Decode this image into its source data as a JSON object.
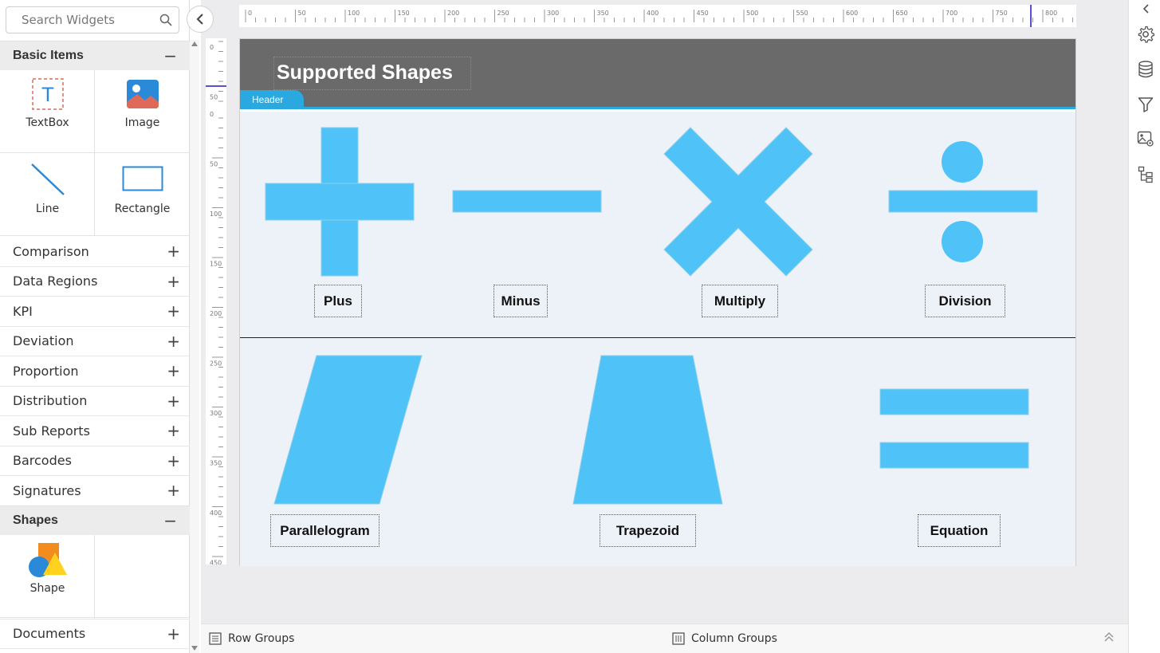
{
  "search": {
    "placeholder": "Search Widgets"
  },
  "sections": {
    "basic_items": {
      "label": "Basic Items",
      "toggle": "−"
    },
    "shapes": {
      "label": "Shapes",
      "toggle": "−"
    }
  },
  "basic_widgets": [
    {
      "label": "TextBox",
      "icon": "textbox-icon"
    },
    {
      "label": "Image",
      "icon": "image-icon"
    },
    {
      "label": "Line",
      "icon": "line-icon"
    },
    {
      "label": "Rectangle",
      "icon": "rectangle-icon"
    }
  ],
  "groups": [
    {
      "label": "Comparison",
      "toggle": "+"
    },
    {
      "label": "Data Regions",
      "toggle": "+"
    },
    {
      "label": "KPI",
      "toggle": "+"
    },
    {
      "label": "Deviation",
      "toggle": "+"
    },
    {
      "label": "Proportion",
      "toggle": "+"
    },
    {
      "label": "Distribution",
      "toggle": "+"
    },
    {
      "label": "Sub Reports",
      "toggle": "+"
    },
    {
      "label": "Barcodes",
      "toggle": "+"
    },
    {
      "label": "Signatures",
      "toggle": "+"
    }
  ],
  "shape_widget": {
    "label": "Shape",
    "icon": "shape-icon"
  },
  "documents": {
    "label": "Documents",
    "toggle": "+"
  },
  "ruler": {
    "top_ticks": [
      "0",
      "50",
      "100",
      "150",
      "200",
      "250",
      "300",
      "350",
      "400",
      "450",
      "500",
      "550",
      "600",
      "650",
      "700",
      "750",
      "800"
    ],
    "left_header_ticks": [
      "0",
      "50"
    ],
    "left_body_ticks": [
      "0",
      "50",
      "100",
      "150",
      "200",
      "250",
      "300",
      "350",
      "400",
      "450"
    ]
  },
  "report": {
    "title": "Supported Shapes",
    "header_tab": "Header",
    "shape_labels": {
      "plus": "Plus",
      "minus": "Minus",
      "multiply": "Multiply",
      "division": "Division",
      "parallelogram": "Parallelogram",
      "trapezoid": "Trapezoid",
      "equation": "Equation"
    }
  },
  "bottom_bar": {
    "row_groups": "Row Groups",
    "column_groups": "Column Groups"
  },
  "colors": {
    "shape_fill": "#4fc3f7",
    "accent": "#2aa9e0",
    "header_band": "#6a6a6a",
    "body_band": "#edf2f8"
  },
  "right_panel_icons": [
    "collapse-right-icon",
    "settings-gear-icon",
    "database-icon",
    "filter-icon",
    "image-settings-icon",
    "report-tree-icon"
  ]
}
